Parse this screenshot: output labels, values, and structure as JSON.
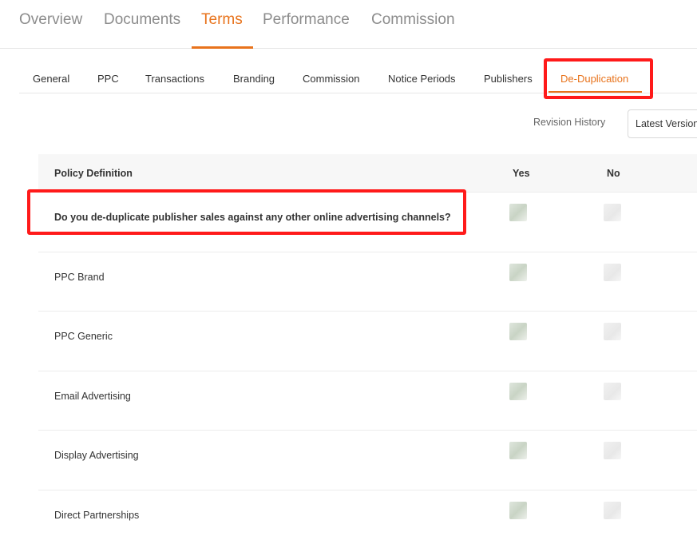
{
  "top_tabs": [
    "Overview",
    "Documents",
    "Terms",
    "Performance",
    "Commission"
  ],
  "active_top_tab": "Terms",
  "sub_tabs": [
    "General",
    "PPC",
    "Transactions",
    "Branding",
    "Commission",
    "Notice Periods",
    "Publishers",
    "De-Duplication"
  ],
  "active_sub_tab": "De-Duplication",
  "revision": {
    "label": "Revision History",
    "selected": "Latest Version"
  },
  "table": {
    "headers": {
      "policy": "Policy Definition",
      "yes": "Yes",
      "no": "No"
    },
    "rows": [
      "Do you de-duplicate publisher sales against any other online advertising channels?",
      "PPC Brand",
      "PPC Generic",
      "Email Advertising",
      "Display Advertising",
      "Direct Partnerships"
    ]
  },
  "colors": {
    "accent": "#e8731c",
    "highlight": "#ff1a1a",
    "header_bg": "#f7f7f7"
  }
}
